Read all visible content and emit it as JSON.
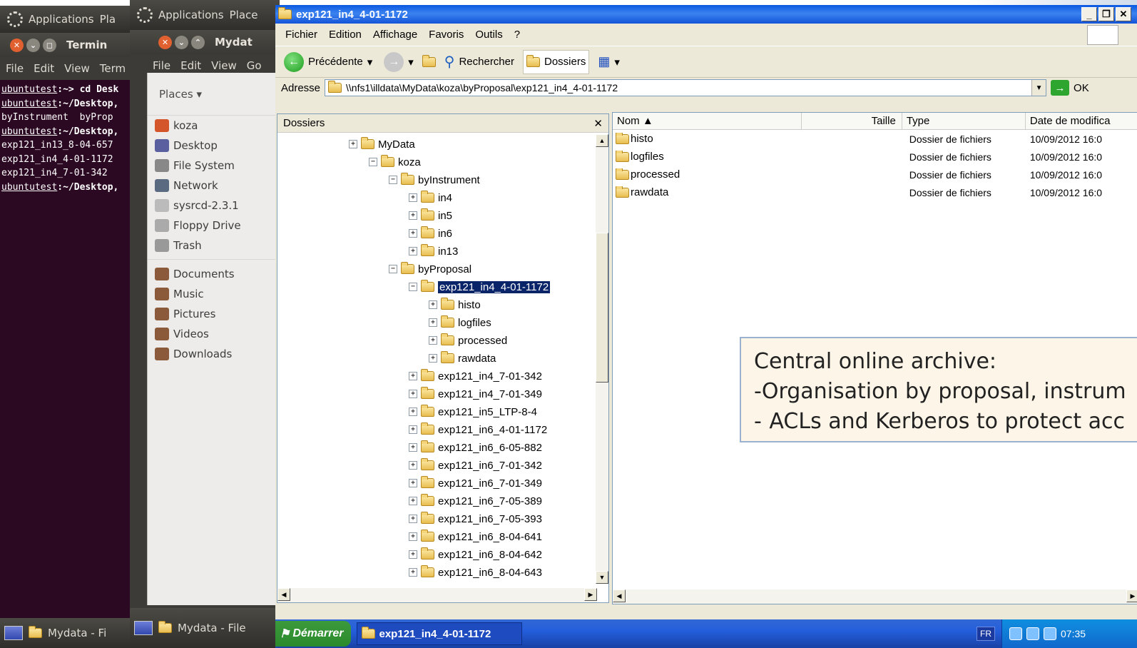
{
  "terminal": {
    "panel_label": "Applications",
    "panel_next": "Pla",
    "window_title": "Termin",
    "menu": [
      "File",
      "Edit",
      "View",
      "Term"
    ],
    "lines": [
      {
        "prompt": "ubuntutest",
        "text": ":~> cd Desk"
      },
      {
        "prompt": "ubuntutest",
        "text": ":~/Desktop,"
      },
      {
        "prompt": "",
        "text": "byInstrument  byProp"
      },
      {
        "prompt": "ubuntutest",
        "text": ":~/Desktop,"
      },
      {
        "prompt": "",
        "text": "exp121_in13_8-04-657"
      },
      {
        "prompt": "",
        "text": "exp121_in4_4-01-1172"
      },
      {
        "prompt": "",
        "text": "exp121_in4_7-01-342"
      },
      {
        "prompt": "ubuntutest",
        "text": ":~/Desktop,"
      }
    ],
    "taskbar_label": "Mydata - Fi"
  },
  "nautilus": {
    "panel_label": "Applications",
    "panel_next": "Place",
    "window_title": "Mydat",
    "menu": [
      "File",
      "Edit",
      "View",
      "Go"
    ],
    "places_header": "Places ▾",
    "places": [
      "koza",
      "Desktop",
      "File System",
      "Network",
      "sysrcd-2.3.1",
      "Floppy Drive",
      "Trash"
    ],
    "bookmarks": [
      "Documents",
      "Music",
      "Pictures",
      "Videos",
      "Downloads"
    ],
    "taskbar_label": "Mydata - File"
  },
  "explorer": {
    "title": "exp121_in4_4-01-1172",
    "menu": [
      "Fichier",
      "Edition",
      "Affichage",
      "Favoris",
      "Outils",
      "?"
    ],
    "toolbar": {
      "back": "Précédente",
      "search": "Rechercher",
      "folders": "Dossiers"
    },
    "address_label": "Adresse",
    "address_value": "\\\\nfs1\\illdata\\MyData\\koza\\byProposal\\exp121_in4_4-01-1172",
    "go_label": "OK",
    "folders_header": "Dossiers",
    "tree": [
      {
        "label": "MyData",
        "level": 0,
        "exp": "+"
      },
      {
        "label": "koza",
        "level": 1,
        "exp": "-"
      },
      {
        "label": "byInstrument",
        "level": 2,
        "exp": "-"
      },
      {
        "label": "in4",
        "level": 3,
        "exp": "+"
      },
      {
        "label": "in5",
        "level": 3,
        "exp": "+"
      },
      {
        "label": "in6",
        "level": 3,
        "exp": "+"
      },
      {
        "label": "in13",
        "level": 3,
        "exp": "+"
      },
      {
        "label": "byProposal",
        "level": 2,
        "exp": "-"
      },
      {
        "label": "exp121_in4_4-01-1172",
        "level": 3,
        "exp": "-",
        "selected": true
      },
      {
        "label": "histo",
        "level": 4,
        "exp": "+"
      },
      {
        "label": "logfiles",
        "level": 4,
        "exp": "+"
      },
      {
        "label": "processed",
        "level": 4,
        "exp": "+"
      },
      {
        "label": "rawdata",
        "level": 4,
        "exp": "+"
      },
      {
        "label": "exp121_in4_7-01-342",
        "level": 3,
        "exp": "+"
      },
      {
        "label": "exp121_in4_7-01-349",
        "level": 3,
        "exp": "+"
      },
      {
        "label": "exp121_in5_LTP-8-4",
        "level": 3,
        "exp": "+"
      },
      {
        "label": "exp121_in6_4-01-1172",
        "level": 3,
        "exp": "+"
      },
      {
        "label": "exp121_in6_6-05-882",
        "level": 3,
        "exp": "+"
      },
      {
        "label": "exp121_in6_7-01-342",
        "level": 3,
        "exp": "+"
      },
      {
        "label": "exp121_in6_7-01-349",
        "level": 3,
        "exp": "+"
      },
      {
        "label": "exp121_in6_7-05-389",
        "level": 3,
        "exp": "+"
      },
      {
        "label": "exp121_in6_7-05-393",
        "level": 3,
        "exp": "+"
      },
      {
        "label": "exp121_in6_8-04-641",
        "level": 3,
        "exp": "+"
      },
      {
        "label": "exp121_in6_8-04-642",
        "level": 3,
        "exp": "+"
      },
      {
        "label": "exp121_in6_8-04-643",
        "level": 3,
        "exp": "+"
      }
    ],
    "columns": [
      "Nom ▲",
      "Taille",
      "Type",
      "Date de modifica"
    ],
    "files": [
      {
        "name": "histo",
        "type": "Dossier de fichiers",
        "date": "10/09/2012 16:0"
      },
      {
        "name": "logfiles",
        "type": "Dossier de fichiers",
        "date": "10/09/2012 16:0"
      },
      {
        "name": "processed",
        "type": "Dossier de fichiers",
        "date": "10/09/2012 16:0"
      },
      {
        "name": "rawdata",
        "type": "Dossier de fichiers",
        "date": "10/09/2012 16:0"
      }
    ],
    "start_label": "Démarrer",
    "taskbar_item": "exp121_in4_4-01-1172",
    "lang": "FR",
    "clock": "07:35"
  },
  "callout": {
    "title": "Central online archive:",
    "bullets": [
      "Organisation by proposal, instrum",
      "ACLs and Kerberos to protect acc"
    ]
  }
}
